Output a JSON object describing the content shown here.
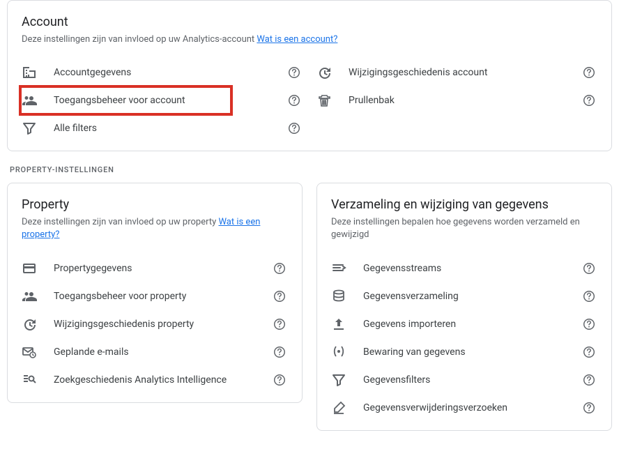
{
  "account": {
    "title": "Account",
    "subtitle": "Deze instellingen zijn van invloed op uw Analytics-account ",
    "link": "Wat is een account?",
    "items_left": [
      {
        "icon": "domain",
        "label": "Accountgegevens"
      },
      {
        "icon": "people",
        "label": "Toegangsbeheer voor account",
        "highlight": true
      },
      {
        "icon": "filter",
        "label": "Alle filters"
      }
    ],
    "items_right": [
      {
        "icon": "history",
        "label": "Wijzigingsgeschiedenis account"
      },
      {
        "icon": "trash",
        "label": "Prullenbak"
      }
    ]
  },
  "section_label": "PROPERTY-INSTELLINGEN",
  "property": {
    "title": "Property",
    "subtitle": "Deze instellingen zijn van invloed op uw property ",
    "link": "Wat is een property?",
    "items": [
      {
        "icon": "card",
        "label": "Propertygegevens"
      },
      {
        "icon": "people",
        "label": "Toegangsbeheer voor property"
      },
      {
        "icon": "history",
        "label": "Wijzigingsgeschiedenis property"
      },
      {
        "icon": "mailclock",
        "label": "Geplande e-mails"
      },
      {
        "icon": "searchlist",
        "label": "Zoekgeschiedenis Analytics Intelligence"
      }
    ]
  },
  "collection": {
    "title": "Verzameling en wijziging van gegevens",
    "subtitle": "Deze instellingen bepalen hoe gegevens worden verzameld en gewijzigd",
    "items": [
      {
        "icon": "streams",
        "label": "Gegevensstreams"
      },
      {
        "icon": "db",
        "label": "Gegevensverzameling"
      },
      {
        "icon": "upload",
        "label": "Gegevens importeren"
      },
      {
        "icon": "retention",
        "label": "Bewaring van gegevens"
      },
      {
        "icon": "filter",
        "label": "Gegevensfilters"
      },
      {
        "icon": "erase",
        "label": "Gegevensverwijderingsverzoeken"
      }
    ]
  }
}
